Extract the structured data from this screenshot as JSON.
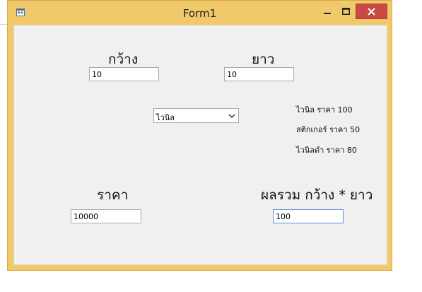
{
  "window": {
    "title": "Form1",
    "colors": {
      "frame": "#f0c96a",
      "close_button": "#c94a44",
      "client": "#f0f0f0"
    },
    "icons": {
      "app": "app-icon",
      "minimize": "minimize-icon",
      "maximize": "maximize-icon",
      "close": "close-icon"
    }
  },
  "form": {
    "width_label": "กว้าง",
    "width_value": "10",
    "length_label": "ยาว",
    "length_value": "10",
    "material_select": {
      "selected": "ไวนิล"
    },
    "price_list": [
      "ไวนิล ราคา 100",
      "สติกเกอร์ ราคา 50",
      "ไวนิลดำ ราคา 80"
    ],
    "price_label": "ราคา",
    "price_value": "10000",
    "area_label": "ผลรวม กว้าง * ยาว",
    "area_value": "100"
  }
}
